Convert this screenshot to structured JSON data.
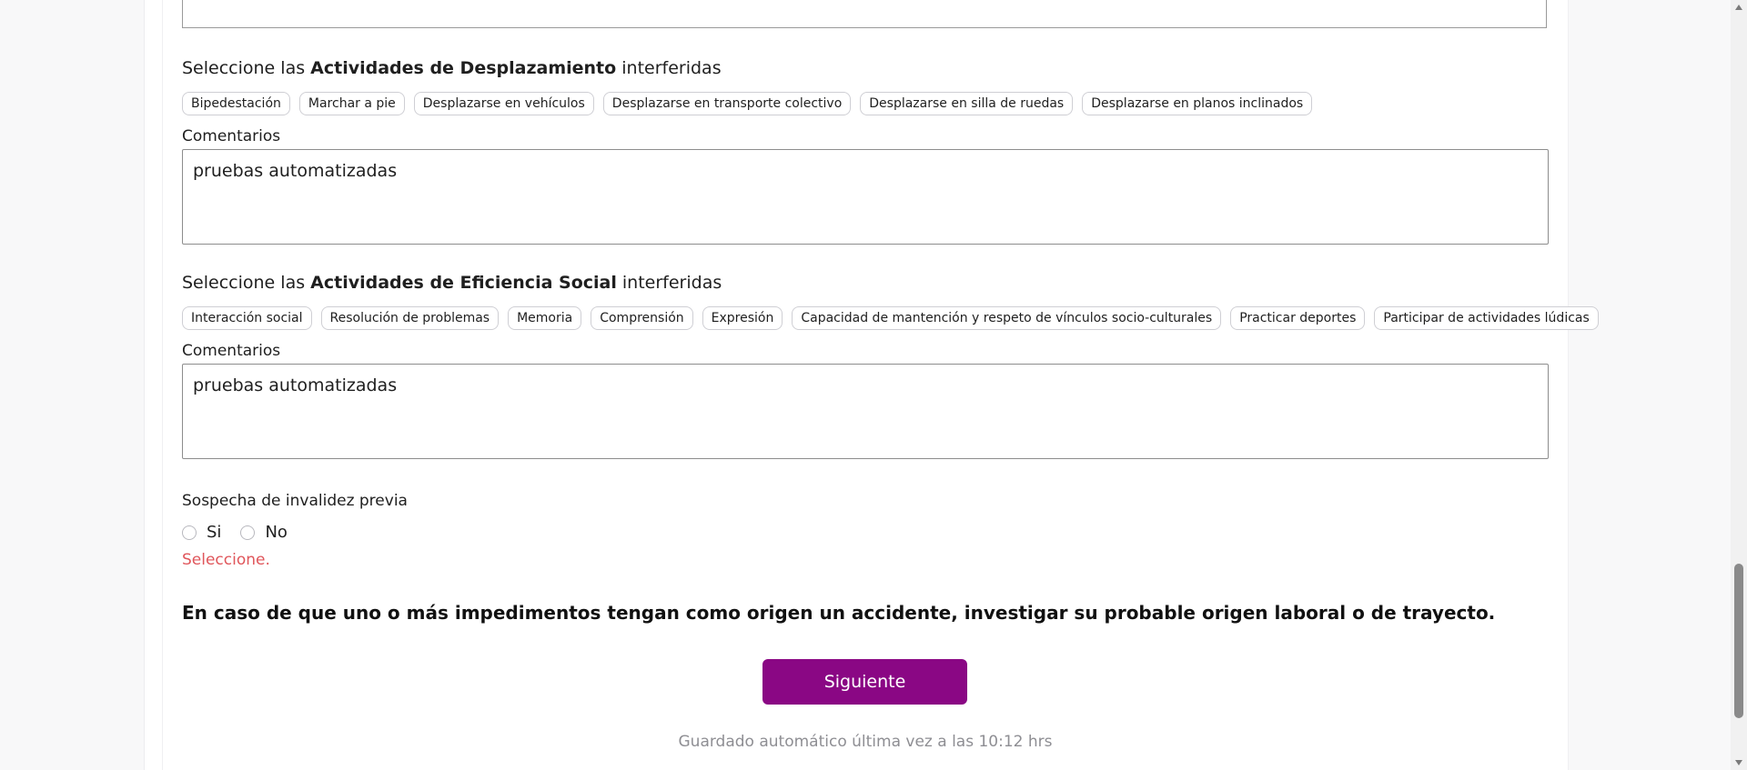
{
  "desplazamiento": {
    "title_prefix": "Seleccione las",
    "title_bold": "Actividades de Desplazamiento",
    "title_suffix": "interferidas",
    "chips": [
      "Bipedestación",
      "Marchar a pie",
      "Desplazarse en vehículos",
      "Desplazarse en transporte colectivo",
      "Desplazarse en silla de ruedas",
      "Desplazarse en planos inclinados"
    ],
    "comments_label": "Comentarios",
    "comments_value": "pruebas automatizadas"
  },
  "eficiencia_social": {
    "title_prefix": "Seleccione las",
    "title_bold": "Actividades de Eficiencia Social",
    "title_suffix": "interferidas",
    "chips": [
      "Interacción social",
      "Resolución de problemas",
      "Memoria",
      "Comprensión",
      "Expresión",
      "Capacidad de mantención y respeto de vínculos socio-culturales",
      "Practicar deportes",
      "Participar de actividades lúdicas"
    ],
    "comments_label": "Comentarios",
    "comments_value": "pruebas automatizadas"
  },
  "invalidez": {
    "label": "Sospecha de invalidez previa",
    "options": [
      "Si",
      "No"
    ],
    "error": "Seleccione."
  },
  "notice": "En caso de que uno o más impedimentos tengan como origen un accidente, investigar su probable origen laboral o de trayecto.",
  "next_button": "Siguiente",
  "autosave": "Guardado automático última vez a las 10:12 hrs",
  "colors": {
    "primary": "#8a0784",
    "error": "#e0565b"
  }
}
